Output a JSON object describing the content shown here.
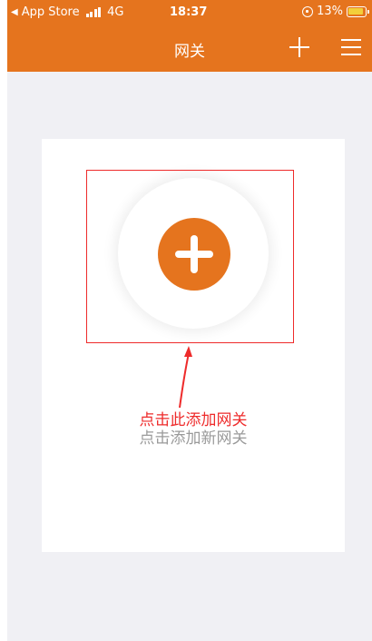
{
  "status_bar": {
    "back_app": "App Store",
    "network": "4G",
    "time": "18:37",
    "battery_percent": "13%"
  },
  "nav": {
    "title": "网关",
    "add_icon": "plus-icon",
    "menu_icon": "hamburger-icon"
  },
  "main": {
    "add_button_icon": "plus-circle-icon",
    "annotation": "点击此添加网关",
    "hint": "点击添加新网关"
  },
  "colors": {
    "brand": "#e5741e",
    "annotation_red": "#ee2b2b",
    "hint_gray": "#9a9a9a",
    "page_bg": "#f0f0f4",
    "battery_yellow": "#f3cf3a"
  }
}
